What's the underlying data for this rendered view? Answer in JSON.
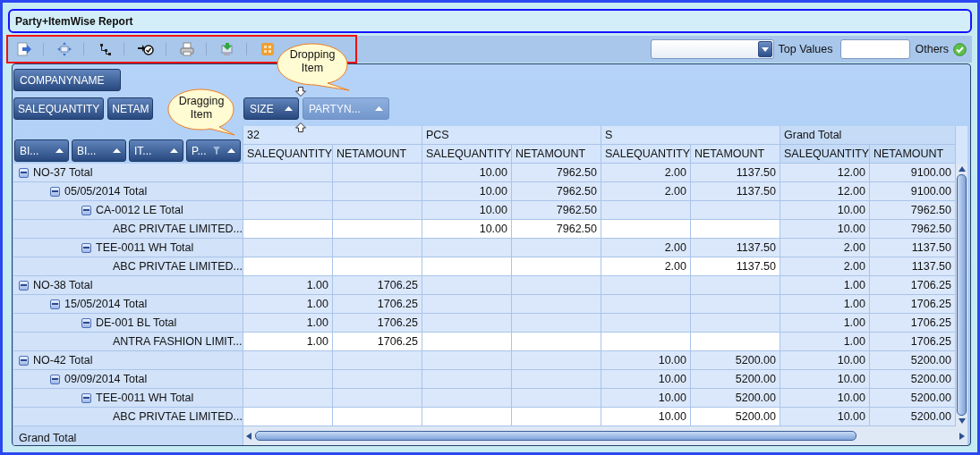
{
  "window": {
    "title": "Party+ItemWise Report"
  },
  "top_values": {
    "label": "Top Values",
    "others_label": "Others"
  },
  "pivot": {
    "filter_fields": [
      {
        "label": "COMPANYNAME"
      }
    ],
    "data_fields": [
      {
        "label": "SALEQUANTITY"
      },
      {
        "label": "NETAM"
      }
    ],
    "column_fields": [
      {
        "label": "SIZE",
        "dragging": false
      },
      {
        "label": "PARTYN...",
        "dragging": true
      }
    ],
    "row_fields": [
      {
        "label": "BI...",
        "filtered": false
      },
      {
        "label": "BI...",
        "filtered": false
      },
      {
        "label": "IT...",
        "filtered": false
      },
      {
        "label": "P...",
        "filtered": true
      }
    ],
    "column_groups": [
      {
        "label": "32",
        "kind": "value",
        "measures": [
          "SALEQUANTITY",
          "NETAMOUNT"
        ]
      },
      {
        "label": "PCS",
        "kind": "value",
        "measures": [
          "SALEQUANTITY",
          "NETAMOUNT"
        ]
      },
      {
        "label": "S",
        "kind": "value",
        "measures": [
          "SALEQUANTITY",
          "NETAMOUNT"
        ]
      },
      {
        "label": "Grand Total",
        "kind": "total",
        "measures": [
          "SALEQUANTITY",
          "NETAMOUNT"
        ]
      }
    ],
    "rows": [
      {
        "label": "NO-37 Total",
        "expanded": true,
        "pcs": {
          "salequantity": "10.00",
          "netamount": "7962.50"
        },
        "s": {
          "salequantity": "2.00",
          "netamount": "1137.50"
        },
        "grand_total": {
          "salequantity": "12.00",
          "netamount": "9100.00"
        },
        "children": [
          {
            "label": "05/05/2014 Total",
            "expanded": true,
            "pcs": {
              "salequantity": "10.00",
              "netamount": "7962.50"
            },
            "s": {
              "salequantity": "2.00",
              "netamount": "1137.50"
            },
            "grand_total": {
              "salequantity": "12.00",
              "netamount": "9100.00"
            },
            "children": [
              {
                "label": "CA-0012 LE Total",
                "expanded": true,
                "pcs": {
                  "salequantity": "10.00",
                  "netamount": "7962.50"
                },
                "grand_total": {
                  "salequantity": "10.00",
                  "netamount": "7962.50"
                },
                "children": [
                  {
                    "label": "ABC PRIVTAE LIMITED...",
                    "pcs": {
                      "salequantity": "10.00",
                      "netamount": "7962.50"
                    },
                    "grand_total": {
                      "salequantity": "10.00",
                      "netamount": "7962.50"
                    }
                  }
                ]
              },
              {
                "label": "TEE-0011 WH Total",
                "expanded": true,
                "s": {
                  "salequantity": "2.00",
                  "netamount": "1137.50"
                },
                "grand_total": {
                  "salequantity": "2.00",
                  "netamount": "1137.50"
                },
                "children": [
                  {
                    "label": "ABC PRIVTAE LIMITED...",
                    "s": {
                      "salequantity": "2.00",
                      "netamount": "1137.50"
                    },
                    "grand_total": {
                      "salequantity": "2.00",
                      "netamount": "1137.50"
                    }
                  }
                ]
              }
            ]
          }
        ]
      },
      {
        "label": "NO-38 Total",
        "expanded": true,
        "size_32": {
          "salequantity": "1.00",
          "netamount": "1706.25"
        },
        "grand_total": {
          "salequantity": "1.00",
          "netamount": "1706.25"
        },
        "children": [
          {
            "label": "15/05/2014 Total",
            "expanded": true,
            "size_32": {
              "salequantity": "1.00",
              "netamount": "1706.25"
            },
            "grand_total": {
              "salequantity": "1.00",
              "netamount": "1706.25"
            },
            "children": [
              {
                "label": "DE-001 BL Total",
                "expanded": true,
                "size_32": {
                  "salequantity": "1.00",
                  "netamount": "1706.25"
                },
                "grand_total": {
                  "salequantity": "1.00",
                  "netamount": "1706.25"
                },
                "children": [
                  {
                    "label": "ANTRA FASHION LIMIT...",
                    "size_32": {
                      "salequantity": "1.00",
                      "netamount": "1706.25"
                    },
                    "grand_total": {
                      "salequantity": "1.00",
                      "netamount": "1706.25"
                    }
                  }
                ]
              }
            ]
          }
        ]
      },
      {
        "label": "NO-42 Total",
        "expanded": true,
        "s": {
          "salequantity": "10.00",
          "netamount": "5200.00"
        },
        "grand_total": {
          "salequantity": "10.00",
          "netamount": "5200.00"
        },
        "children": [
          {
            "label": "09/09/2014 Total",
            "expanded": true,
            "s": {
              "salequantity": "10.00",
              "netamount": "5200.00"
            },
            "grand_total": {
              "salequantity": "10.00",
              "netamount": "5200.00"
            },
            "children": [
              {
                "label": "TEE-0011 WH Total",
                "expanded": true,
                "s": {
                  "salequantity": "10.00",
                  "netamount": "5200.00"
                },
                "grand_total": {
                  "salequantity": "10.00",
                  "netamount": "5200.00"
                },
                "children": [
                  {
                    "label": "ABC PRIVTAE LIMITED...",
                    "s": {
                      "salequantity": "10.00",
                      "netamount": "5200.00"
                    },
                    "grand_total": {
                      "salequantity": "10.00",
                      "netamount": "5200.00"
                    }
                  }
                ]
              }
            ]
          }
        ]
      }
    ],
    "grand_total_label": "Grand Total"
  },
  "callouts": [
    {
      "kind": "dropping",
      "text": "Dropping Item"
    },
    {
      "kind": "dragging",
      "text": "Dragging Item"
    }
  ]
}
